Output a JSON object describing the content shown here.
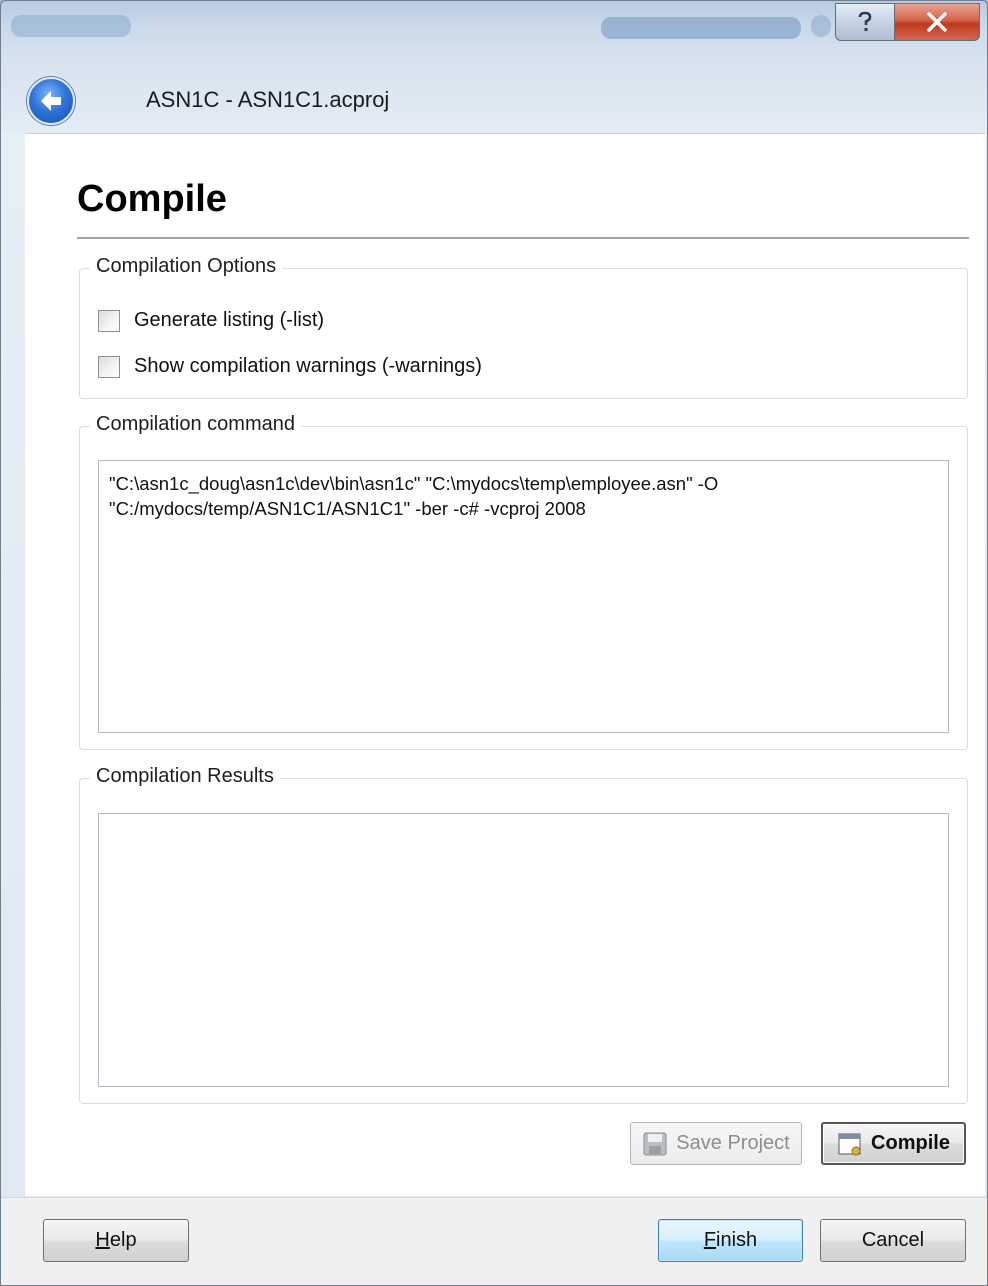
{
  "window": {
    "title": "ASN1C - ASN1C1.acproj",
    "caption_help_icon": "question-icon",
    "caption_close_icon": "close-icon"
  },
  "page": {
    "heading": "Compile"
  },
  "options": {
    "group_label": "Compilation Options",
    "generate_listing": {
      "label": "Generate listing (-list)",
      "checked": false
    },
    "show_warnings": {
      "label": "Show compilation warnings (-warnings)",
      "checked": false
    }
  },
  "command": {
    "group_label": "Compilation command",
    "text": "\"C:\\asn1c_doug\\asn1c\\dev\\bin\\asn1c\" \"C:\\mydocs\\temp\\employee.asn\" -O\n\"C:/mydocs/temp/ASN1C1/ASN1C1\" -ber -c# -vcproj 2008"
  },
  "results": {
    "group_label": "Compilation Results",
    "text": ""
  },
  "actions": {
    "save_project_label": "Save Project",
    "compile_label": "Compile"
  },
  "footer": {
    "help_mnemonic": "H",
    "help_rest": "elp",
    "finish_mnemonic": "F",
    "finish_rest": "inish",
    "cancel_label": "Cancel"
  }
}
